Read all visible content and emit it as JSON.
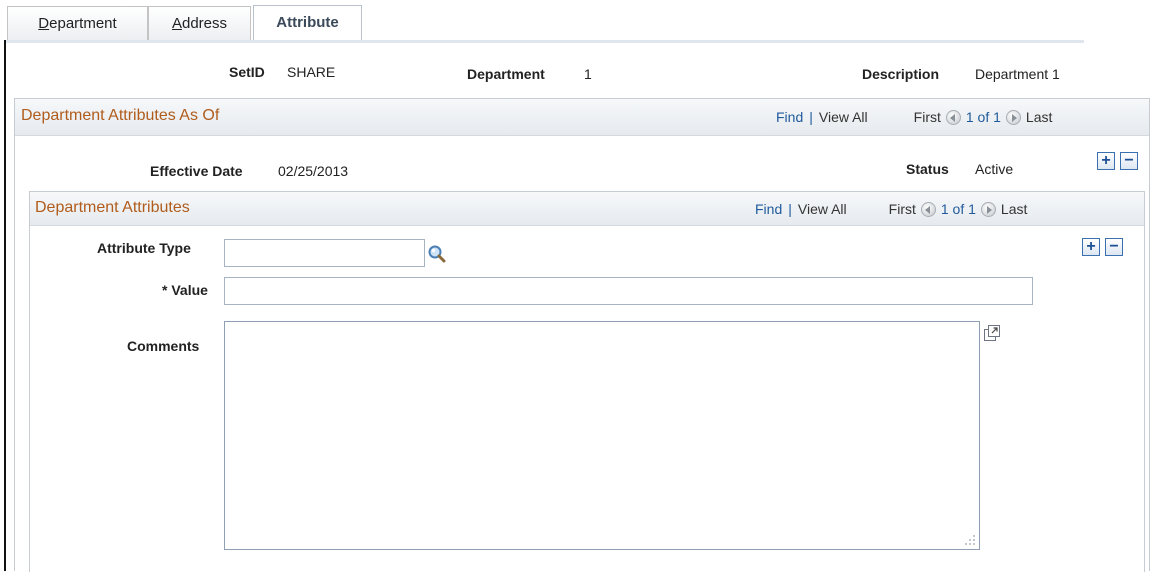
{
  "tabs": [
    {
      "label": "Department",
      "underline": "D",
      "rest": "epartment"
    },
    {
      "label": "Address",
      "underline": "A",
      "rest": "ddress"
    },
    {
      "label": "Attribute"
    }
  ],
  "header": {
    "setid_label": "SetID",
    "setid_value": "SHARE",
    "department_label": "Department",
    "department_value": "1",
    "description_label": "Description",
    "description_value": "Department 1"
  },
  "outer": {
    "title": "Department Attributes As Of",
    "find": "Find",
    "sep": "|",
    "view_all": "View All",
    "first": "First",
    "count": "1 of 1",
    "last": "Last",
    "effective_date_label": "Effective Date",
    "effective_date_value": "02/25/2013",
    "status_label": "Status",
    "status_value": "Active",
    "add": "+",
    "remove": "−"
  },
  "inner": {
    "title": "Department Attributes",
    "find": "Find",
    "sep": "|",
    "view_all": "View All",
    "first": "First",
    "count": "1 of 1",
    "last": "Last",
    "add": "+",
    "remove": "−",
    "attribute_type_label": "Attribute Type",
    "attribute_type_value": "",
    "value_label": "* Value",
    "value_value": "",
    "comments_label": "Comments",
    "comments_value": ""
  },
  "colors": {
    "section_title": "#b05c1c",
    "link": "#1f5a9c"
  },
  "icons": [
    "search-icon",
    "expand-icon",
    "previous-icon",
    "next-icon",
    "resize-grip-icon"
  ]
}
